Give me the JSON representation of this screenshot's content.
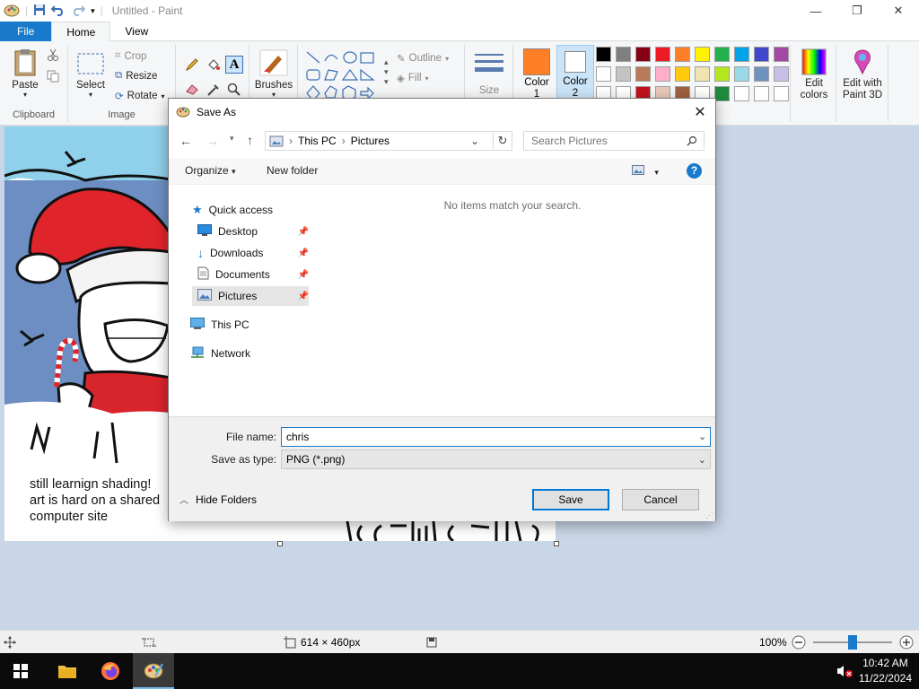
{
  "window": {
    "title": "Untitled - Paint"
  },
  "tabs": [
    {
      "label": "File"
    },
    {
      "label": "Home"
    },
    {
      "label": "View"
    }
  ],
  "ribbon": {
    "clipboard": {
      "label": "Clipboard",
      "paste": "Paste"
    },
    "image": {
      "label": "Image",
      "select": "Select",
      "crop": "Crop",
      "resize": "Resize",
      "rotate": "Rotate"
    },
    "tools": {
      "brushes": "Brushes"
    },
    "shapes": {
      "outline": "Outline",
      "fill": "Fill"
    },
    "size": "Size",
    "color1": "Color 1",
    "color2": "Color 2",
    "edit_colors": "Edit colors",
    "paint3d": "Edit with Paint 3D",
    "palette_row1": [
      "#000000",
      "#7f7f7f",
      "#880015",
      "#ed1c24",
      "#ff7f27",
      "#fff200",
      "#22b14c",
      "#00a2e8",
      "#3f48cc",
      "#a349a4"
    ],
    "palette_row2": [
      "#ffffff",
      "#c3c3c3",
      "#b97a57",
      "#ffaec9",
      "#ffc90e",
      "#efe4b0",
      "#b5e61d",
      "#99d9ea",
      "#7092be",
      "#c8bfe7"
    ],
    "palette_row3": [
      "#ffffff",
      "#ffffff",
      "#c3101d",
      "#e8c8b8",
      "#a06040",
      "#ffffff",
      "#1e8a3c",
      "#ffffff",
      "#ffffff",
      "#ffffff"
    ],
    "color1_value": "#ff7f27",
    "color2_value": "#ffffff"
  },
  "canvas": {
    "caption_lines": [
      "still learnign shading!",
      "art is hard on a shared",
      "computer site"
    ],
    "bottom_scribble": "is comic"
  },
  "dialog": {
    "title": "Save As",
    "address": {
      "segments": [
        "This PC",
        "Pictures"
      ]
    },
    "search_placeholder": "Search Pictures",
    "toolbar": {
      "organize": "Organize",
      "new_folder": "New folder"
    },
    "nav": {
      "quick_access": "Quick access",
      "desktop": "Desktop",
      "downloads": "Downloads",
      "documents": "Documents",
      "pictures": "Pictures",
      "this_pc": "This PC",
      "network": "Network"
    },
    "empty_message": "No items match your search.",
    "file_name_label": "File name:",
    "file_name_value": "chris",
    "save_as_type_label": "Save as type:",
    "save_as_type_value": "PNG (*.png)",
    "save": "Save",
    "cancel": "Cancel",
    "hide_folders": "Hide Folders"
  },
  "status": {
    "dimensions": "614 × 460px",
    "zoom": "100%",
    "zoom_level": 0.5
  },
  "taskbar": {
    "time": "10:42 AM",
    "date": "11/22/2024"
  }
}
